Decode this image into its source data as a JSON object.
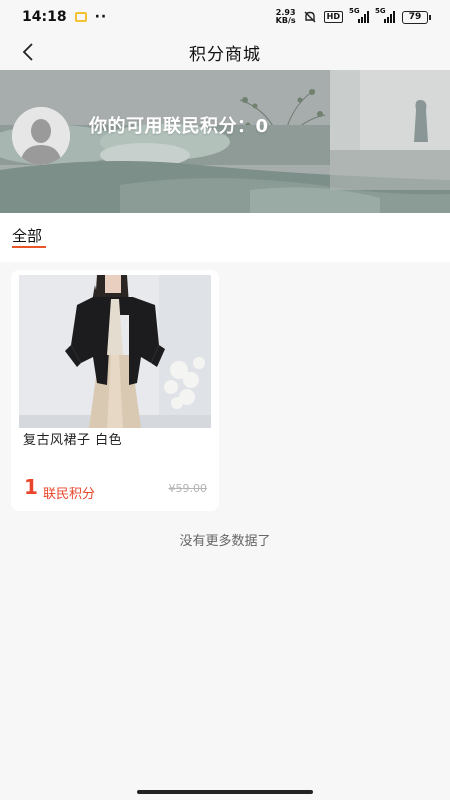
{
  "status_bar": {
    "time": "14:18",
    "net_speed_value": "2.93",
    "net_speed_unit": "KB/s",
    "hd_label": "HD",
    "signal1_label": "5G",
    "signal2_label": "5G",
    "battery": "79"
  },
  "nav": {
    "title": "积分商城"
  },
  "banner": {
    "points_label": "你的可用联民积分：0"
  },
  "tabs": [
    {
      "label": "全部",
      "active": true
    }
  ],
  "products": [
    {
      "name": "复古风裙子 白色",
      "points": "1",
      "points_unit": "联民积分",
      "original_price": "¥59.00"
    }
  ],
  "footer": {
    "no_more_text": "没有更多数据了"
  },
  "colors": {
    "accent": "#e8452a",
    "tab_underline": "#e8562a",
    "background": "#f7f7f7"
  }
}
